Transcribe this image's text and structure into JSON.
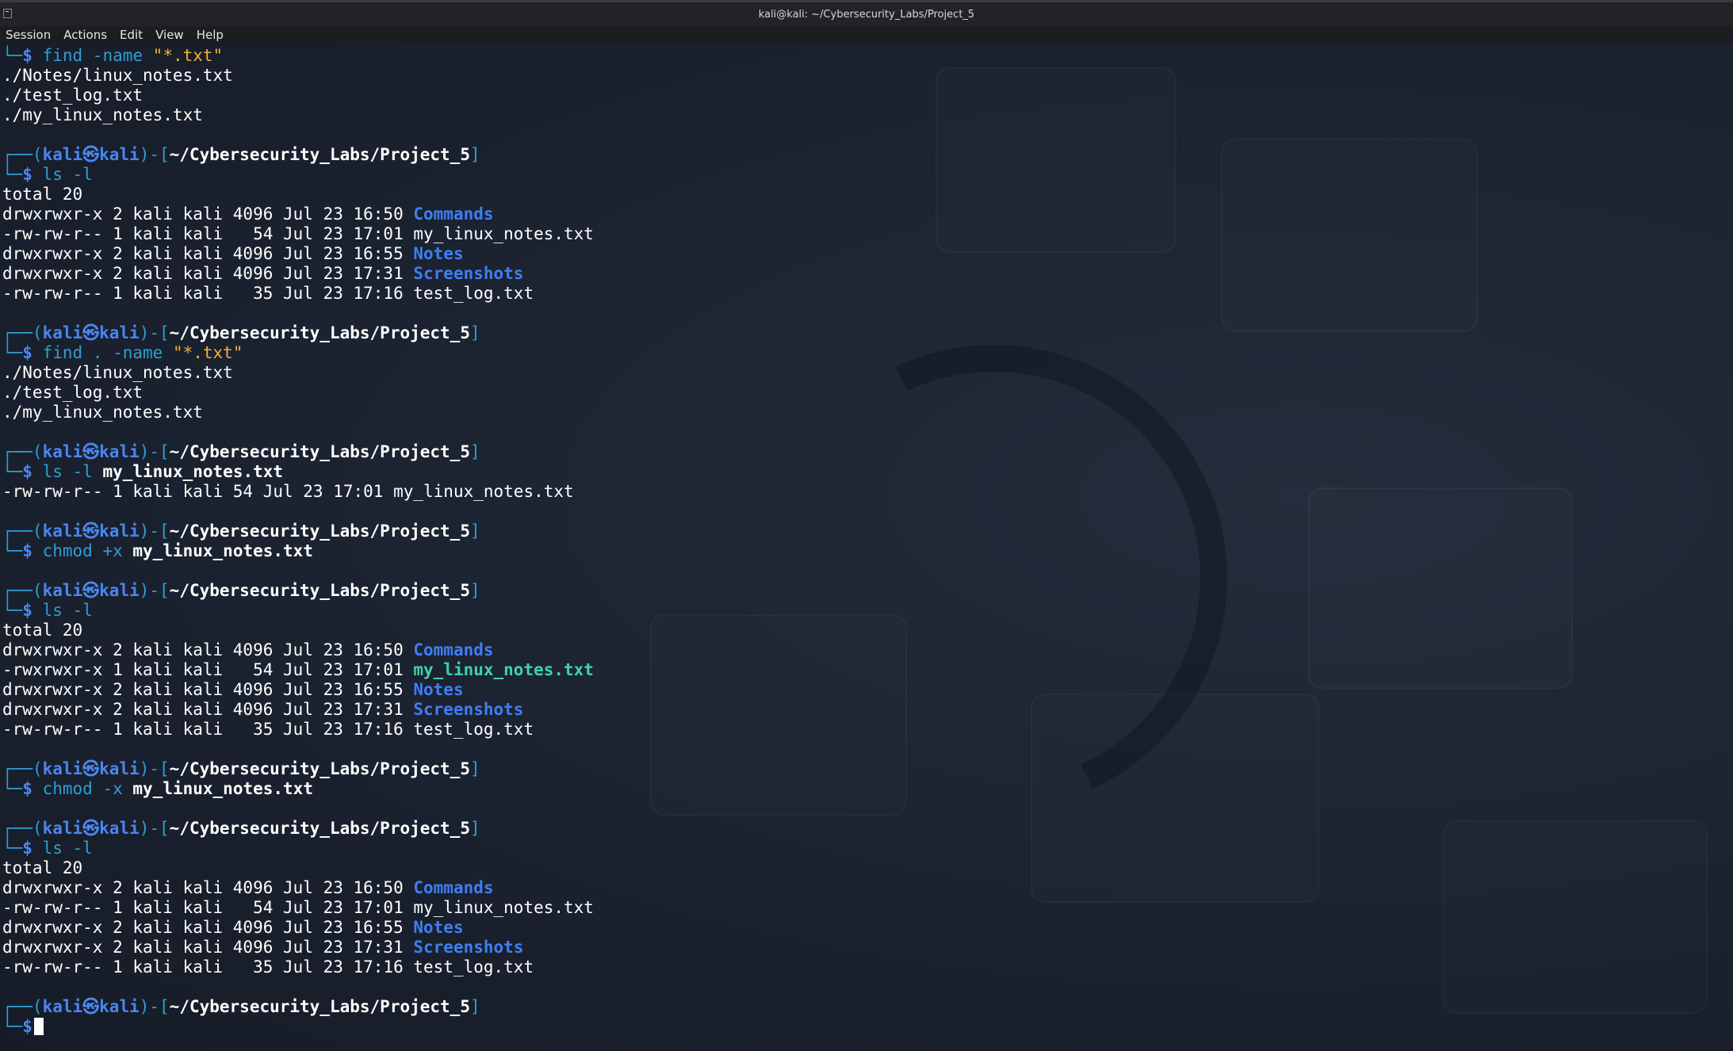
{
  "window": {
    "title": "kali@kali: ~/Cybersecurity_Labs/Project_5"
  },
  "menu": [
    "Session",
    "Actions",
    "Edit",
    "View",
    "Help"
  ],
  "prompt": {
    "user": "kali",
    "host": "kali",
    "path": "~/Cybersecurity_Labs/Project_5"
  },
  "colors": {
    "background": "#1a212d",
    "prompt_frame": "#2e9fd2",
    "prompt_user": "#4a86f0",
    "directory": "#3e7ff2",
    "executable": "#3fd3a9",
    "string": "#f2b134"
  },
  "lines": [
    {
      "type": "cmd",
      "segs": [
        {
          "t": "find -name ",
          "c": "cmd"
        },
        {
          "t": "\"*.txt\"",
          "c": "qs"
        }
      ]
    },
    {
      "type": "out",
      "segs": [
        {
          "t": "./Notes/linux_notes.txt"
        }
      ]
    },
    {
      "type": "out",
      "segs": [
        {
          "t": "./test_log.txt"
        }
      ]
    },
    {
      "type": "out",
      "segs": [
        {
          "t": "./my_linux_notes.txt"
        }
      ]
    },
    {
      "type": "blank"
    },
    {
      "type": "prompt"
    },
    {
      "type": "cmd",
      "segs": [
        {
          "t": "ls -l",
          "c": "cmd"
        }
      ]
    },
    {
      "type": "out",
      "segs": [
        {
          "t": "total 20"
        }
      ]
    },
    {
      "type": "out",
      "segs": [
        {
          "t": "drwxrwxr-x 2 kali kali 4096 Jul 23 16:50 "
        },
        {
          "t": "Commands",
          "c": "dir"
        }
      ]
    },
    {
      "type": "out",
      "segs": [
        {
          "t": "-rw-rw-r-- 1 kali kali   54 Jul 23 17:01 my_linux_notes.txt"
        }
      ]
    },
    {
      "type": "out",
      "segs": [
        {
          "t": "drwxrwxr-x 2 kali kali 4096 Jul 23 16:55 "
        },
        {
          "t": "Notes",
          "c": "dir"
        }
      ]
    },
    {
      "type": "out",
      "segs": [
        {
          "t": "drwxrwxr-x 2 kali kali 4096 Jul 23 17:31 "
        },
        {
          "t": "Screenshots",
          "c": "dir"
        }
      ]
    },
    {
      "type": "out",
      "segs": [
        {
          "t": "-rw-rw-r-- 1 kali kali   35 Jul 23 17:16 test_log.txt"
        }
      ]
    },
    {
      "type": "blank"
    },
    {
      "type": "prompt"
    },
    {
      "type": "cmd",
      "segs": [
        {
          "t": "find . -name ",
          "c": "cmd"
        },
        {
          "t": "\"*.txt\"",
          "c": "qs"
        }
      ]
    },
    {
      "type": "out",
      "segs": [
        {
          "t": "./Notes/linux_notes.txt"
        }
      ]
    },
    {
      "type": "out",
      "segs": [
        {
          "t": "./test_log.txt"
        }
      ]
    },
    {
      "type": "out",
      "segs": [
        {
          "t": "./my_linux_notes.txt"
        }
      ]
    },
    {
      "type": "blank"
    },
    {
      "type": "prompt"
    },
    {
      "type": "cmd",
      "segs": [
        {
          "t": "ls -l ",
          "c": "cmd"
        },
        {
          "t": "my_linux_notes.txt",
          "c": "arg"
        }
      ]
    },
    {
      "type": "out",
      "segs": [
        {
          "t": "-rw-rw-r-- 1 kali kali 54 Jul 23 17:01 my_linux_notes.txt"
        }
      ]
    },
    {
      "type": "blank"
    },
    {
      "type": "prompt"
    },
    {
      "type": "cmd",
      "segs": [
        {
          "t": "chmod +x ",
          "c": "cmd"
        },
        {
          "t": "my_linux_notes.txt",
          "c": "arg"
        }
      ]
    },
    {
      "type": "blank"
    },
    {
      "type": "prompt"
    },
    {
      "type": "cmd",
      "segs": [
        {
          "t": "ls -l",
          "c": "cmd"
        }
      ]
    },
    {
      "type": "out",
      "segs": [
        {
          "t": "total 20"
        }
      ]
    },
    {
      "type": "out",
      "segs": [
        {
          "t": "drwxrwxr-x 2 kali kali 4096 Jul 23 16:50 "
        },
        {
          "t": "Commands",
          "c": "dir"
        }
      ]
    },
    {
      "type": "out",
      "segs": [
        {
          "t": "-rwxrwxr-x 1 kali kali   54 Jul 23 17:01 "
        },
        {
          "t": "my_linux_notes.txt",
          "c": "exe"
        }
      ]
    },
    {
      "type": "out",
      "segs": [
        {
          "t": "drwxrwxr-x 2 kali kali 4096 Jul 23 16:55 "
        },
        {
          "t": "Notes",
          "c": "dir"
        }
      ]
    },
    {
      "type": "out",
      "segs": [
        {
          "t": "drwxrwxr-x 2 kali kali 4096 Jul 23 17:31 "
        },
        {
          "t": "Screenshots",
          "c": "dir"
        }
      ]
    },
    {
      "type": "out",
      "segs": [
        {
          "t": "-rw-rw-r-- 1 kali kali   35 Jul 23 17:16 test_log.txt"
        }
      ]
    },
    {
      "type": "blank"
    },
    {
      "type": "prompt"
    },
    {
      "type": "cmd",
      "segs": [
        {
          "t": "chmod -x ",
          "c": "cmd"
        },
        {
          "t": "my_linux_notes.txt",
          "c": "arg"
        }
      ]
    },
    {
      "type": "blank"
    },
    {
      "type": "prompt"
    },
    {
      "type": "cmd",
      "segs": [
        {
          "t": "ls -l",
          "c": "cmd"
        }
      ]
    },
    {
      "type": "out",
      "segs": [
        {
          "t": "total 20"
        }
      ]
    },
    {
      "type": "out",
      "segs": [
        {
          "t": "drwxrwxr-x 2 kali kali 4096 Jul 23 16:50 "
        },
        {
          "t": "Commands",
          "c": "dir"
        }
      ]
    },
    {
      "type": "out",
      "segs": [
        {
          "t": "-rw-rw-r-- 1 kali kali   54 Jul 23 17:01 my_linux_notes.txt"
        }
      ]
    },
    {
      "type": "out",
      "segs": [
        {
          "t": "drwxrwxr-x 2 kali kali 4096 Jul 23 16:55 "
        },
        {
          "t": "Notes",
          "c": "dir"
        }
      ]
    },
    {
      "type": "out",
      "segs": [
        {
          "t": "drwxrwxr-x 2 kali kali 4096 Jul 23 17:31 "
        },
        {
          "t": "Screenshots",
          "c": "dir"
        }
      ]
    },
    {
      "type": "out",
      "segs": [
        {
          "t": "-rw-rw-r-- 1 kali kali   35 Jul 23 17:16 test_log.txt"
        }
      ]
    },
    {
      "type": "blank"
    },
    {
      "type": "prompt"
    },
    {
      "type": "input"
    }
  ]
}
